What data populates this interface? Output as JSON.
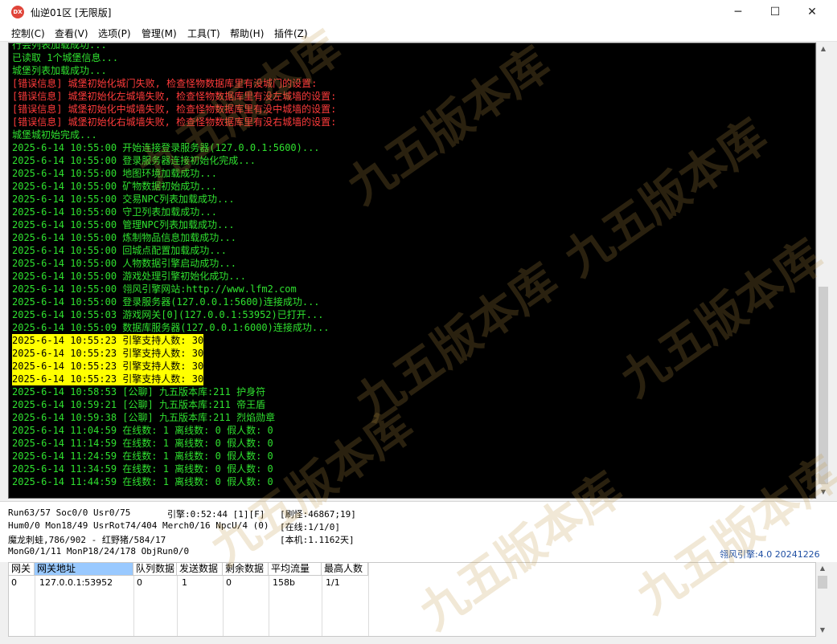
{
  "window": {
    "title": "仙逆01区 [无限版]",
    "icon_text": "DX",
    "controls": {
      "minimize": "─",
      "maximize": "☐",
      "close": "✕"
    }
  },
  "menu": {
    "items": [
      "控制(C)",
      "查看(V)",
      "选项(P)",
      "管理(M)",
      "工具(T)",
      "帮助(H)",
      "插件(Z)"
    ]
  },
  "console": {
    "lines": [
      {
        "text": "行会列表加载成功...",
        "kind": "normal"
      },
      {
        "text": "已读取 1个城堡信息...",
        "kind": "normal"
      },
      {
        "text": "城堡列表加载成功...",
        "kind": "normal"
      },
      {
        "text": "[错误信息] 城堡初始化城门失败, 检查怪物数据库里有没城门的设置:",
        "kind": "error"
      },
      {
        "text": "[错误信息] 城堡初始化左城墙失败, 检查怪物数据库里有没左城墙的设置:",
        "kind": "error"
      },
      {
        "text": "[错误信息] 城堡初始化中城墙失败, 检查怪物数据库里有没中城墙的设置:",
        "kind": "error"
      },
      {
        "text": "[错误信息] 城堡初始化右城墙失败, 检查怪物数据库里有没右城墙的设置:",
        "kind": "error"
      },
      {
        "text": "城堡城初始完成...",
        "kind": "normal"
      },
      {
        "text": "2025-6-14 10:55:00 开始连接登录服务器(127.0.0.1:5600)...",
        "kind": "normal"
      },
      {
        "text": "2025-6-14 10:55:00 登录服务器连接初始化完成...",
        "kind": "normal"
      },
      {
        "text": "2025-6-14 10:55:00 地图环境加载成功...",
        "kind": "normal"
      },
      {
        "text": "2025-6-14 10:55:00 矿物数据初始成功...",
        "kind": "normal"
      },
      {
        "text": "2025-6-14 10:55:00 交易NPC列表加载成功...",
        "kind": "normal"
      },
      {
        "text": "2025-6-14 10:55:00 守卫列表加载成功...",
        "kind": "normal"
      },
      {
        "text": "2025-6-14 10:55:00 管理NPC列表加载成功...",
        "kind": "normal"
      },
      {
        "text": "2025-6-14 10:55:00 炼制物品信息加载成功...",
        "kind": "normal"
      },
      {
        "text": "2025-6-14 10:55:00 回城点配置加载成功...",
        "kind": "normal"
      },
      {
        "text": "2025-6-14 10:55:00 人物数据引擎启动成功...",
        "kind": "normal"
      },
      {
        "text": "2025-6-14 10:55:00 游戏处理引擎初始化成功...",
        "kind": "normal"
      },
      {
        "text": "2025-6-14 10:55:00 翎风引擎网站:http://www.lfm2.com",
        "kind": "normal"
      },
      {
        "text": "2025-6-14 10:55:00 登录服务器(127.0.0.1:5600)连接成功...",
        "kind": "normal"
      },
      {
        "text": "2025-6-14 10:55:03 游戏网关[0](127.0.0.1:53952)已打开...",
        "kind": "normal"
      },
      {
        "text": "2025-6-14 10:55:09 数据库服务器(127.0.0.1:6000)连接成功...",
        "kind": "normal"
      },
      {
        "text": "2025-6-14 10:55:23 引擎支持人数: 30",
        "kind": "highlight"
      },
      {
        "text": "2025-6-14 10:55:23 引擎支持人数: 30",
        "kind": "highlight"
      },
      {
        "text": "2025-6-14 10:55:23 引擎支持人数: 30",
        "kind": "highlight"
      },
      {
        "text": "2025-6-14 10:55:23 引擎支持人数: 30",
        "kind": "highlight"
      },
      {
        "text": "2025-6-14 10:58:53 [公聊] 九五版本库:211 护身符",
        "kind": "normal"
      },
      {
        "text": "2025-6-14 10:59:21 [公聊] 九五版本库:211 帝王盾",
        "kind": "normal"
      },
      {
        "text": "2025-6-14 10:59:38 [公聊] 九五版本库:211 烈焰勋章",
        "kind": "normal"
      },
      {
        "text": "2025-6-14 11:04:59 在线数: 1 离线数: 0 假人数: 0",
        "kind": "normal"
      },
      {
        "text": "2025-6-14 11:14:59 在线数: 1 离线数: 0 假人数: 0",
        "kind": "normal"
      },
      {
        "text": "2025-6-14 11:24:59 在线数: 1 离线数: 0 假人数: 0",
        "kind": "normal"
      },
      {
        "text": "2025-6-14 11:34:59 在线数: 1 离线数: 0 假人数: 0",
        "kind": "normal"
      },
      {
        "text": "2025-6-14 11:44:59 在线数: 1 离线数: 0 假人数: 0",
        "kind": "normal"
      }
    ]
  },
  "status": {
    "run": "Run63/57 Soc0/0 Usr0/75",
    "engine_time": "引擎:0:52:44 [1][F]",
    "refresh": "[刷怪:46867;19]",
    "hum": "Hum0/0 Mon18/49 UsrRot74/404 Merch0/16 NpcU/4 (0)",
    "online": "[在线:1/1/0]",
    "mob": "魔龙刺蛙,786/902 - 红野猪/584/17",
    "local": "[本机:1.1162天]",
    "mon": "MonG0/1/11 MonP18/24/178 ObjRun0/0",
    "engine_version": "翎风引擎:4.0 20241226"
  },
  "gateway_table": {
    "headers": [
      "网关",
      "网关地址",
      "队列数据",
      "发送数据",
      "剩余数据",
      "平均流量",
      "最高人数"
    ],
    "rows": [
      [
        "0",
        "127.0.0.1:53952",
        "0",
        "1",
        "0",
        "158b",
        "1/1"
      ]
    ]
  },
  "watermark_text": "九五版本库"
}
